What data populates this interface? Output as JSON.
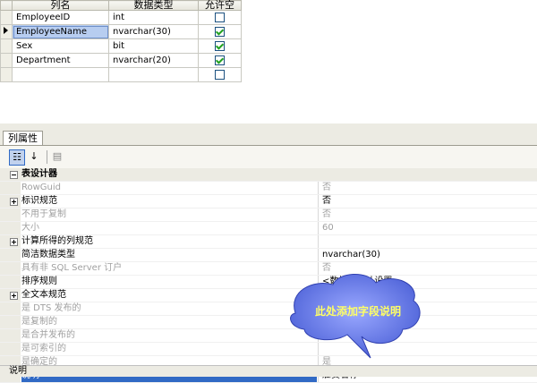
{
  "grid": {
    "headers": [
      "列名",
      "数据类型",
      "允许空"
    ],
    "rows": [
      {
        "name": "EmployeeID",
        "type": "int",
        "nullable": false,
        "current": false
      },
      {
        "name": "EmployeeName",
        "type": "nvarchar(30)",
        "nullable": true,
        "current": true
      },
      {
        "name": "Sex",
        "type": "bit",
        "nullable": true,
        "current": false
      },
      {
        "name": "Department",
        "type": "nvarchar(20)",
        "nullable": true,
        "current": false
      },
      {
        "name": "",
        "type": "",
        "nullable": false,
        "current": false
      }
    ]
  },
  "properties": {
    "tab_label": "列属性",
    "toolbar": {
      "categorized_icon": "categorized-icon",
      "alphabetical_icon": "alphabetical-icon",
      "pages_icon": "property-pages-icon"
    },
    "category": "表设计器",
    "rows": [
      {
        "name": "RowGuid",
        "value": "否",
        "disabled": true,
        "expander": ""
      },
      {
        "name": "标识规范",
        "value": "否",
        "disabled": false,
        "expander": "plus"
      },
      {
        "name": "不用于复制",
        "value": "否",
        "disabled": true,
        "expander": ""
      },
      {
        "name": "大小",
        "value": "60",
        "disabled": true,
        "expander": ""
      },
      {
        "name": "计算所得的列规范",
        "value": "",
        "disabled": false,
        "expander": "plus"
      },
      {
        "name": "简洁数据类型",
        "value": "nvarchar(30)",
        "disabled": false,
        "expander": ""
      },
      {
        "name": "具有非 SQL Server 订户",
        "value": "否",
        "disabled": true,
        "expander": ""
      },
      {
        "name": "排序规则",
        "value": "<数据库默认设置>",
        "disabled": false,
        "expander": ""
      },
      {
        "name": "全文本规范",
        "value": "否",
        "disabled": false,
        "expander": "plus"
      },
      {
        "name": "是 DTS 发布的",
        "value": "",
        "disabled": true,
        "expander": ""
      },
      {
        "name": "是复制的",
        "value": "",
        "disabled": true,
        "expander": ""
      },
      {
        "name": "是合并发布的",
        "value": "",
        "disabled": true,
        "expander": ""
      },
      {
        "name": "是可索引的",
        "value": "",
        "disabled": true,
        "expander": ""
      },
      {
        "name": "是确定的",
        "value": "是",
        "disabled": true,
        "expander": ""
      },
      {
        "name": "说明",
        "value": "雇员名称",
        "disabled": false,
        "expander": "",
        "selected": true
      }
    ],
    "description_title": "说明"
  },
  "callout": {
    "text": "此处添加字段说明",
    "color": "#4a5fd6"
  }
}
